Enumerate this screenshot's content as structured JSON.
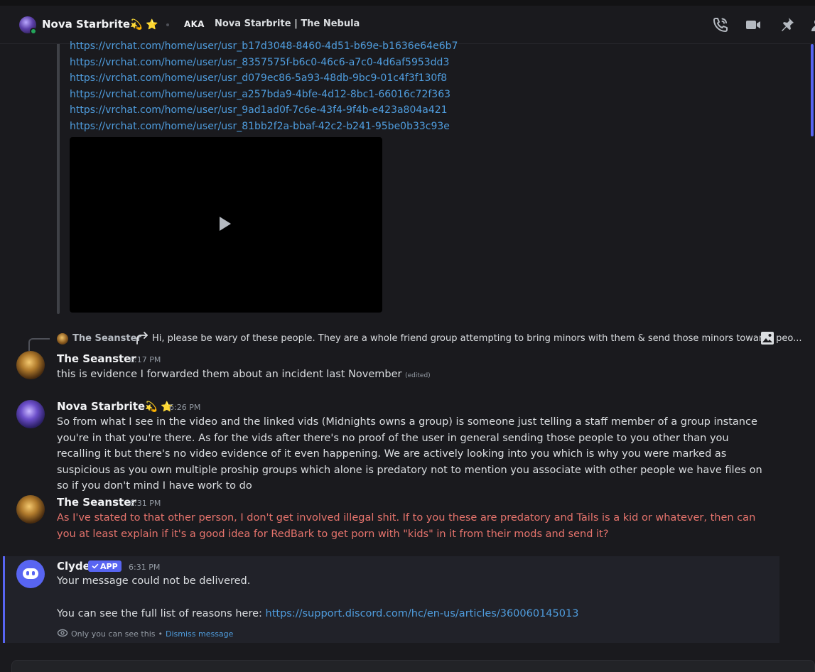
{
  "header": {
    "name": "Nova Starbrite",
    "name_emoji": "💫 ⭐",
    "aka_label": "AKA",
    "nickname": "Nova Starbrite | The Nebula"
  },
  "embed": {
    "links": [
      "https://vrchat.com/home/user/usr_b17d3048-8460-4d51-b69e-b1636e64e6b7",
      "https://vrchat.com/home/user/usr_8357575f-b6c0-46c6-a7c0-4d6af5953dd3",
      "https://vrchat.com/home/user/usr_d079ec86-5a93-48db-9bc9-01c4f3f130f8",
      "https://vrchat.com/home/user/usr_a257bda9-4bfe-4d12-8bc1-66016c72f363",
      "https://vrchat.com/home/user/usr_9ad1ad0f-7c6e-43f4-9f4b-e423a804a421",
      "https://vrchat.com/home/user/usr_81bb2f2a-bbaf-42c2-b241-95be0b33c93e"
    ]
  },
  "reply": {
    "author": "The Seanster",
    "text": "Hi, please be wary of these people. They are a whole friend group attempting to bring minors with them & send those minors towards peo..."
  },
  "messages": [
    {
      "author": "The Seanster",
      "time": "6:17 PM",
      "text": "this is evidence I forwarded them about an incident last November",
      "edited": "(edited)"
    },
    {
      "author": "Nova Starbrite",
      "author_emoji": "💫 ⭐",
      "time": "6:26 PM",
      "text": "So from what I see in the video and the linked vids (Midnights owns a group) is someone just telling a staff member of a group instance you're in that you're there. As for the vids after there's no proof of the user in general sending those people to you other than you recalling it but there's no video evidence of it even happening. We are actively looking into you which is why you were marked as suspicious as you own multiple proship groups which alone is predatory not to mention you associate with other people we have files on so if you don't mind I have work to do"
    },
    {
      "author": "The Seanster",
      "time": "6:31 PM",
      "text": "As I've stated to that other person, I don't get involved illegal shit. If to you these are predatory and Tails is a kid or whatever, then can you at least explain if it's a good idea for RedBark to get porn with \"kids\" in it from their mods and send it?"
    },
    {
      "author": "Clyde",
      "badge": "APP",
      "time": "6:31 PM",
      "line1": "Your message could not be delivered.",
      "line2_prefix": "You can see the full list of reasons here: ",
      "line2_link": "https://support.discord.com/hc/en-us/articles/360060145013",
      "ephemeral_note": "Only you can see this",
      "ephemeral_sep": "•",
      "dismiss": "Dismiss message"
    }
  ],
  "colors": {
    "accent": "#5865f2",
    "link": "#4f9dde",
    "error_text": "#e5736c",
    "online": "#23a55a"
  },
  "icons": [
    "phone-call-icon",
    "video-camera-icon",
    "pin-icon",
    "members-icon",
    "image-icon",
    "reply-arrow-icon",
    "eye-icon",
    "play-icon"
  ]
}
